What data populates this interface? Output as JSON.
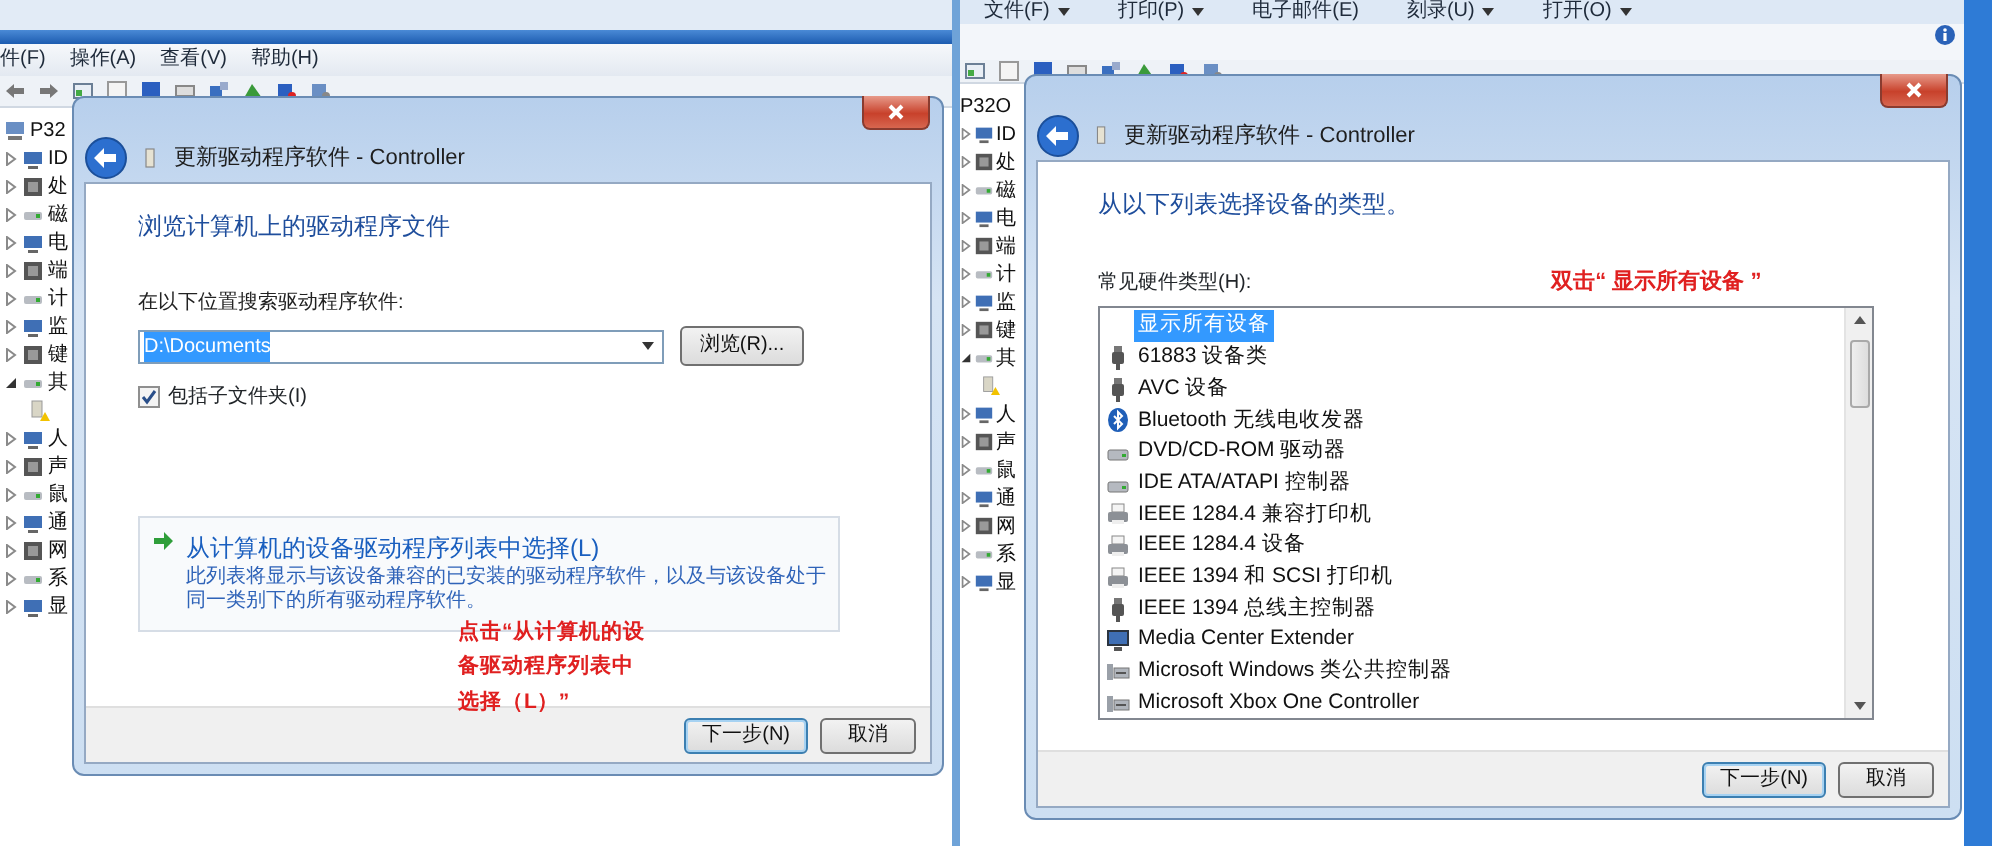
{
  "panes": [
    {
      "menu": [
        {
          "label": "件(F)",
          "dropdown": false
        },
        {
          "label": "操作(A)",
          "dropdown": false
        },
        {
          "label": "查看(V)",
          "dropdown": false
        },
        {
          "label": "帮助(H)",
          "dropdown": false
        }
      ],
      "tree": {
        "root": "P32",
        "items": [
          {
            "label": "ID",
            "expanded": false
          },
          {
            "label": "处",
            "expanded": false
          },
          {
            "label": "磁",
            "expanded": false
          },
          {
            "label": "电",
            "expanded": false
          },
          {
            "label": "端",
            "expanded": false
          },
          {
            "label": "计",
            "expanded": false
          },
          {
            "label": "监",
            "expanded": false
          },
          {
            "label": "键",
            "expanded": false
          },
          {
            "label": "其",
            "expanded": true,
            "children": [
              {
                "kind": "warning-device"
              }
            ]
          },
          {
            "label": "人",
            "expanded": false
          },
          {
            "label": "声",
            "expanded": false
          },
          {
            "label": "鼠",
            "expanded": false
          },
          {
            "label": "通",
            "expanded": false
          },
          {
            "label": "网",
            "expanded": false
          },
          {
            "label": "系",
            "expanded": false
          },
          {
            "label": "显",
            "expanded": false
          }
        ]
      },
      "dialog": {
        "kind": "browse",
        "title": "更新驱动程序软件 - Controller",
        "heading": "浏览计算机上的驱动程序文件",
        "search_label": "在以下位置搜索驱动程序软件:",
        "path": {
          "value": "D:\\Documents",
          "selected": true
        },
        "browse_button": "浏览(R)...",
        "include_subfolders": {
          "label": "包括子文件夹(I)",
          "checked": true
        },
        "pick_link": {
          "title": "从计算机的设备驱动程序列表中选择(L)",
          "description": "此列表将显示与该设备兼容的已安装的驱动程序软件，以及与该设备处于同一类别下的所有驱动程序软件。"
        },
        "annotation": "点击“从计算机的设备驱动程序列表中选择（L）”",
        "buttons": [
          {
            "label": "下一步(N)",
            "default": true
          },
          {
            "label": "取消",
            "default": false
          }
        ]
      }
    },
    {
      "menu": [
        {
          "label": "文件(F)",
          "dropdown": true
        },
        {
          "label": "打印(P)",
          "dropdown": true
        },
        {
          "label": "电子邮件(E)",
          "dropdown": false
        },
        {
          "label": "刻录(U)",
          "dropdown": true
        },
        {
          "label": "打开(O)",
          "dropdown": true
        }
      ],
      "tree": {
        "root": "P32O",
        "items": [
          {
            "label": "ID",
            "expanded": false
          },
          {
            "label": "处",
            "expanded": false
          },
          {
            "label": "磁",
            "expanded": false
          },
          {
            "label": "电",
            "expanded": false
          },
          {
            "label": "端",
            "expanded": false
          },
          {
            "label": "计",
            "expanded": false
          },
          {
            "label": "监",
            "expanded": false
          },
          {
            "label": "键",
            "expanded": false
          },
          {
            "label": "其",
            "expanded": true,
            "children": [
              {
                "kind": "warning-device"
              }
            ]
          },
          {
            "label": "人",
            "expanded": false
          },
          {
            "label": "声",
            "expanded": false
          },
          {
            "label": "鼠",
            "expanded": false
          },
          {
            "label": "通",
            "expanded": false
          },
          {
            "label": "网",
            "expanded": false
          },
          {
            "label": "系",
            "expanded": false
          },
          {
            "label": "显",
            "expanded": false
          }
        ]
      },
      "dialog": {
        "kind": "list",
        "title": "更新驱动程序软件 - Controller",
        "heading": "从以下列表选择设备的类型。",
        "list_label": "常见硬件类型(H):",
        "annotation": "双击“ 显示所有设备 ”",
        "items": [
          {
            "label": "显示所有设备",
            "kind": "blank",
            "selected": true
          },
          {
            "label": "61883 设备类",
            "kind": "plug",
            "selected": false
          },
          {
            "label": "AVC 设备",
            "kind": "plug",
            "selected": false
          },
          {
            "label": "Bluetooth 无线电收发器",
            "kind": "bluetooth",
            "selected": false
          },
          {
            "label": "DVD/CD-ROM 驱动器",
            "kind": "drive",
            "selected": false
          },
          {
            "label": "IDE ATA/ATAPI 控制器",
            "kind": "drive",
            "selected": false
          },
          {
            "label": "IEEE 1284.4 兼容打印机",
            "kind": "printer",
            "selected": false
          },
          {
            "label": "IEEE 1284.4 设备",
            "kind": "printer",
            "selected": false
          },
          {
            "label": "IEEE 1394 和 SCSI 打印机",
            "kind": "printer",
            "selected": false
          },
          {
            "label": "IEEE 1394 总线主控制器",
            "kind": "plug",
            "selected": false
          },
          {
            "label": "Media Center Extender",
            "kind": "monitor",
            "selected": false
          },
          {
            "label": "Microsoft Windows 类公共控制器",
            "kind": "controller",
            "selected": false
          },
          {
            "label": "Microsoft Xbox One Controller",
            "kind": "controller",
            "selected": false
          }
        ],
        "buttons": [
          {
            "label": "下一步(N)",
            "default": true
          },
          {
            "label": "取消",
            "default": false
          }
        ]
      }
    }
  ]
}
